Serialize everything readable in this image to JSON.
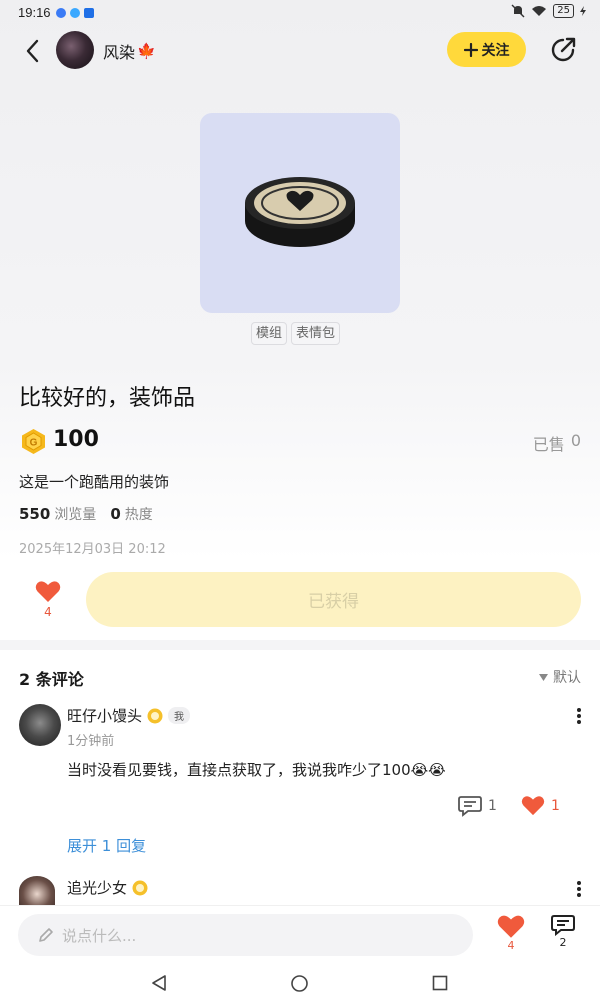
{
  "status_bar": {
    "time": "19:16",
    "battery": "25",
    "app_dot_colors": [
      "#3b7bf5",
      "#3aa8ff",
      "#1f6fe6"
    ]
  },
  "header": {
    "author_name": "风染",
    "follow_label": "关注",
    "accent_color": "#ffd93b"
  },
  "product": {
    "tags": [
      "模组",
      "表情包"
    ],
    "title": "比较好的，装饰品",
    "price": "100",
    "sold_label": "已售",
    "sold_count": "0",
    "description": "这是一个跑酷用的装饰",
    "views_value": "550",
    "views_label": "浏览量",
    "heat_value": "0",
    "heat_label": "热度",
    "date": "2025年12月03日 20:12",
    "like_count": "4",
    "obtained_label": "已获得"
  },
  "comments": {
    "header": "2 条评论",
    "sort_label": "默认",
    "items": [
      {
        "name": "旺仔小馒头",
        "badge": "我",
        "time": "1分钟前",
        "text": "当时没看见要钱，直接点获取了，我说我咋少了100😭😭",
        "reply_count": "1",
        "like_count": "1",
        "expand_label": "展开 1 回复"
      },
      {
        "name": "追光少女"
      }
    ]
  },
  "bottom_bar": {
    "input_placeholder": "说点什么...",
    "like_count": "4",
    "comment_count": "2"
  },
  "icons": {
    "back": "back-arrow-icon",
    "share": "share-icon",
    "coin": "coin-icon",
    "heart": "heart-icon",
    "comment": "comment-icon",
    "pencil": "pencil-icon"
  },
  "colors": {
    "like_red": "#e8573c",
    "link_blue": "#3d8fd8",
    "product_bg": "#d9ddf3"
  }
}
